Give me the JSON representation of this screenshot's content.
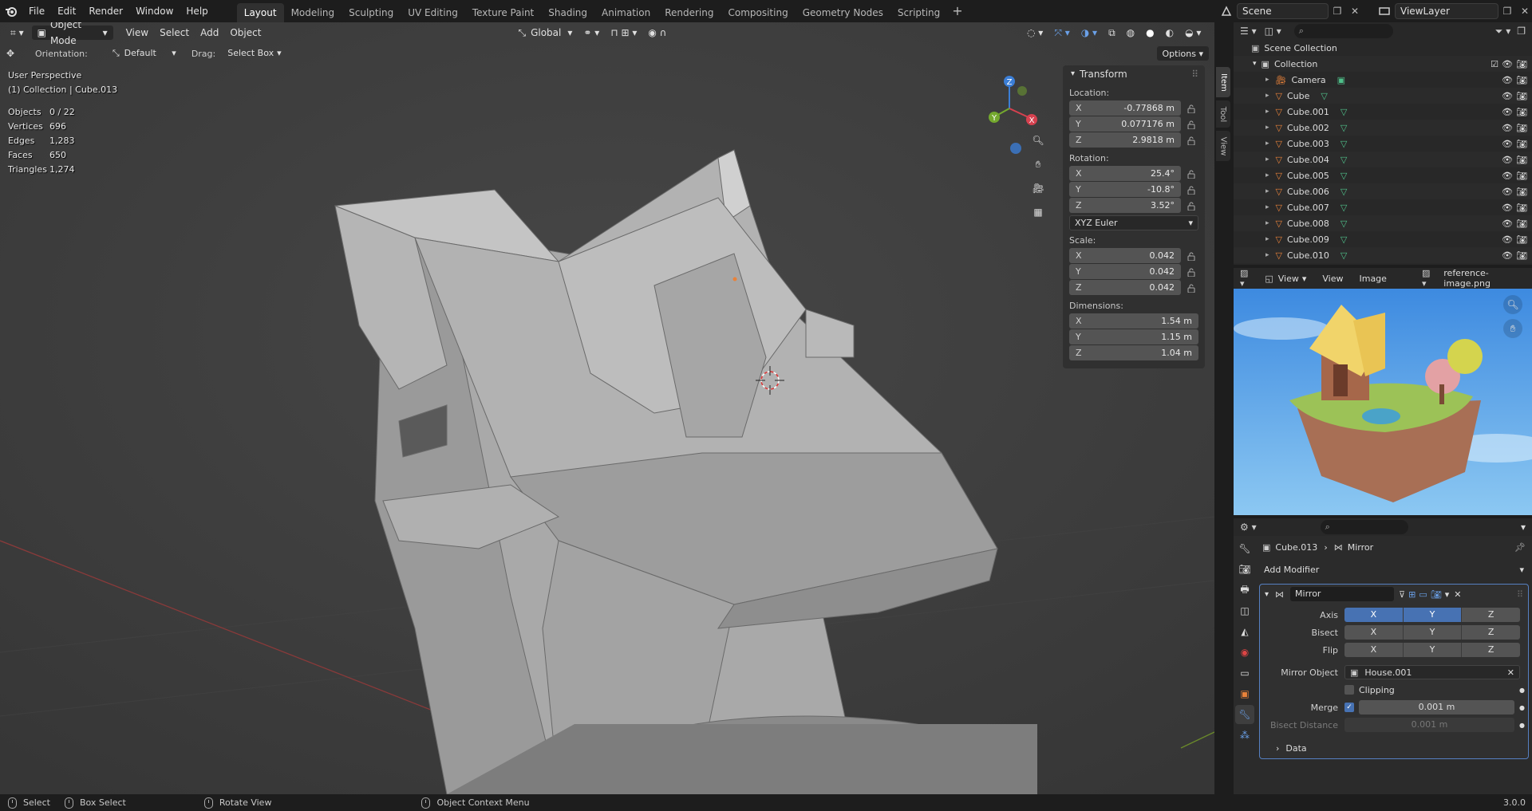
{
  "topbar": {
    "menus": [
      "File",
      "Edit",
      "Render",
      "Window",
      "Help"
    ],
    "workspaces": [
      "Layout",
      "Modeling",
      "Sculpting",
      "UV Editing",
      "Texture Paint",
      "Shading",
      "Animation",
      "Rendering",
      "Compositing",
      "Geometry Nodes",
      "Scripting"
    ],
    "active_workspace": "Layout",
    "scene": "Scene",
    "view_layer": "ViewLayer"
  },
  "viewport": {
    "header": {
      "mode": "Object Mode",
      "menus": [
        "View",
        "Select",
        "Add",
        "Object"
      ],
      "transform_orientation": "Global",
      "options": "Options"
    },
    "toolsettings": {
      "orientation_label": "Orientation:",
      "orientation_value": "Default",
      "drag_label": "Drag:",
      "drag_value": "Select Box"
    },
    "overlay_text": {
      "perspective": "User Perspective",
      "collection": "(1) Collection | Cube.013"
    },
    "stats": [
      {
        "label": "Objects",
        "value": "0 / 22"
      },
      {
        "label": "Vertices",
        "value": "696"
      },
      {
        "label": "Edges",
        "value": "1,283"
      },
      {
        "label": "Faces",
        "value": "650"
      },
      {
        "label": "Triangles",
        "value": "1,274"
      }
    ],
    "gizmo_axes": [
      "X",
      "Y",
      "Z"
    ],
    "sidebar_tabs": [
      "Item",
      "Tool",
      "View"
    ],
    "transform_panel": {
      "title": "Transform",
      "location_label": "Location:",
      "location": [
        {
          "axis": "X",
          "value": "-0.77868 m"
        },
        {
          "axis": "Y",
          "value": "0.077176 m"
        },
        {
          "axis": "Z",
          "value": "2.9818 m"
        }
      ],
      "rotation_label": "Rotation:",
      "rotation": [
        {
          "axis": "X",
          "value": "25.4°"
        },
        {
          "axis": "Y",
          "value": "-10.8°"
        },
        {
          "axis": "Z",
          "value": "3.52°"
        }
      ],
      "rotation_mode": "XYZ Euler",
      "scale_label": "Scale:",
      "scale": [
        {
          "axis": "X",
          "value": "0.042"
        },
        {
          "axis": "Y",
          "value": "0.042"
        },
        {
          "axis": "Z",
          "value": "0.042"
        }
      ],
      "dimensions_label": "Dimensions:",
      "dimensions": [
        {
          "axis": "X",
          "value": "1.54 m"
        },
        {
          "axis": "Y",
          "value": "1.15 m"
        },
        {
          "axis": "Z",
          "value": "1.04 m"
        }
      ]
    }
  },
  "outliner": {
    "root": "Scene Collection",
    "collection": "Collection",
    "items": [
      "Camera",
      "Cube",
      "Cube.001",
      "Cube.002",
      "Cube.003",
      "Cube.004",
      "Cube.005",
      "Cube.006",
      "Cube.007",
      "Cube.008",
      "Cube.009",
      "Cube.010"
    ]
  },
  "image_editor": {
    "menus": [
      "View",
      "View",
      "Image"
    ],
    "image_name": "reference-image.png"
  },
  "properties": {
    "breadcrumb_object": "Cube.013",
    "breadcrumb_modifier": "Mirror",
    "add_modifier": "Add Modifier",
    "modifier": {
      "name": "Mirror",
      "axis_label": "Axis",
      "bisect_label": "Bisect",
      "flip_label": "Flip",
      "axes": [
        "X",
        "Y",
        "Z"
      ],
      "axis_on": [
        true,
        true,
        false
      ],
      "mirror_object_label": "Mirror Object",
      "mirror_object": "House.001",
      "clipping_label": "Clipping",
      "clipping": false,
      "merge_label": "Merge",
      "merge": true,
      "merge_value": "0.001 m",
      "bisect_distance_label": "Bisect Distance",
      "bisect_distance": "0.001 m",
      "data_label": "Data"
    }
  },
  "statusbar": {
    "items": [
      "Select",
      "Box Select",
      "Rotate View",
      "Object Context Menu"
    ],
    "version": "3.0.0"
  },
  "colors": {
    "accent": "#4772b3",
    "viewport_bg": "#3c3c3c",
    "mesh_orange": "#e8823a",
    "mesh_green": "#4fc08a"
  }
}
